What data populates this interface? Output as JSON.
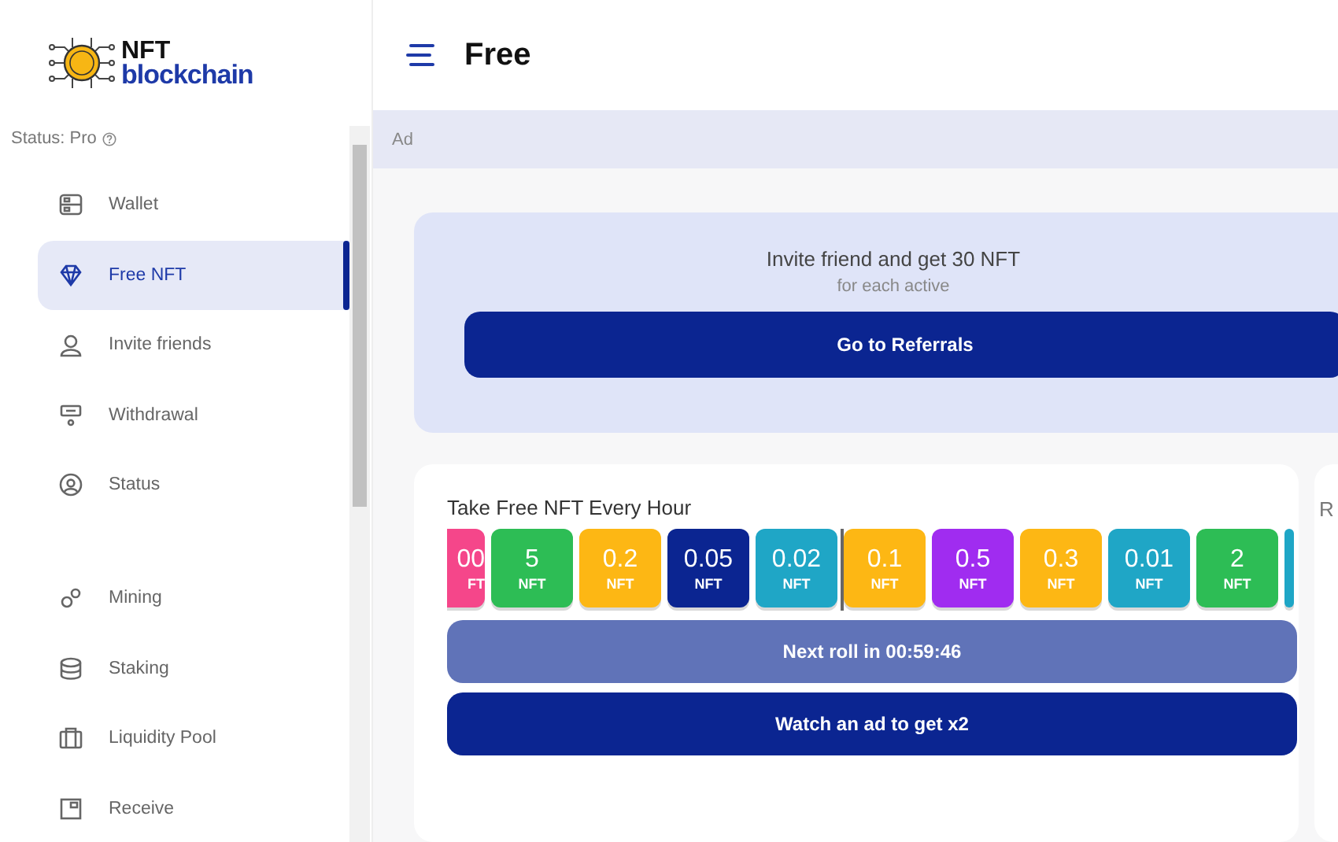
{
  "logo": {
    "top": "NFT",
    "bottom": "blockchain"
  },
  "status": {
    "label": "Status: Pro"
  },
  "sidebar": {
    "groups": [
      [
        {
          "label": "Wallet",
          "selected": false
        },
        {
          "label": "Free NFT",
          "selected": true
        },
        {
          "label": "Invite friends",
          "selected": false
        },
        {
          "label": "Withdrawal",
          "selected": false
        },
        {
          "label": "Status",
          "selected": false
        }
      ],
      [
        {
          "label": "Mining",
          "selected": false
        },
        {
          "label": "Staking",
          "selected": false
        },
        {
          "label": "Liquidity Pool",
          "selected": false
        },
        {
          "label": "Receive",
          "selected": false
        }
      ]
    ]
  },
  "header": {
    "title": "Free"
  },
  "ad": {
    "label": "Ad"
  },
  "invite": {
    "title": "Invite friend and get 30 NFT",
    "subtitle": "for each active",
    "button": "Go to Referrals"
  },
  "roll": {
    "title": "Take Free NFT Every Hour",
    "tiles": [
      {
        "value": "00",
        "unit": "FT",
        "color": "#f5468a",
        "kind": "partial"
      },
      {
        "value": "5",
        "unit": "NFT",
        "color": "#2dbd55",
        "kind": "full"
      },
      {
        "value": "0.2",
        "unit": "NFT",
        "color": "#fdb714",
        "kind": "full"
      },
      {
        "value": "0.05",
        "unit": "NFT",
        "color": "#0b2591",
        "kind": "full"
      },
      {
        "value": "0.02",
        "unit": "NFT",
        "color": "#1fa6c6",
        "kind": "full"
      },
      {
        "value": "0.1",
        "unit": "NFT",
        "color": "#fdb714",
        "kind": "full"
      },
      {
        "value": "0.5",
        "unit": "NFT",
        "color": "#a02cf0",
        "kind": "full"
      },
      {
        "value": "0.3",
        "unit": "NFT",
        "color": "#fdb714",
        "kind": "full"
      },
      {
        "value": "0.01",
        "unit": "NFT",
        "color": "#1fa6c6",
        "kind": "full"
      },
      {
        "value": "2",
        "unit": "NFT",
        "color": "#2dbd55",
        "kind": "full"
      },
      {
        "color": "#1fa6c6",
        "kind": "sliver"
      }
    ],
    "next_button": "Next roll in 00:59:46",
    "watch_button": "Watch an ad to get x2"
  },
  "side_card": {
    "heading": "R"
  }
}
